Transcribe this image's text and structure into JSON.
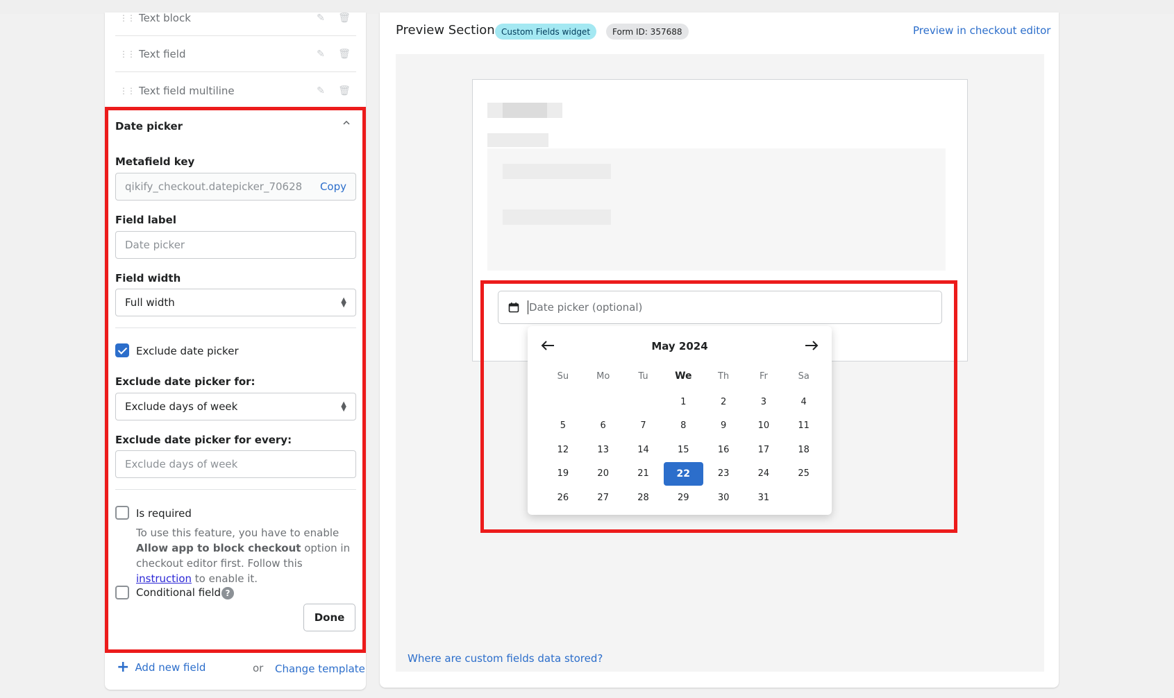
{
  "field_list": [
    {
      "label": "Text block"
    },
    {
      "label": "Text field"
    },
    {
      "label": "Text field multiline"
    }
  ],
  "date_picker_panel": {
    "title": "Date picker",
    "metafield_key_label": "Metafield key",
    "metafield_key_value": "qikify_checkout.datepicker_70628",
    "copy_label": "Copy",
    "field_label_label": "Field label",
    "field_label_placeholder": "Date picker",
    "field_width_label": "Field width",
    "field_width_value": "Full width",
    "exclude_checkbox_label": "Exclude date picker",
    "exclude_checked": true,
    "exclude_for_label": "Exclude date picker for:",
    "exclude_for_value": "Exclude days of week",
    "exclude_every_label": "Exclude date picker for every:",
    "exclude_every_placeholder": "Exclude days of week",
    "is_required_label": "Is required",
    "is_required_checked": false,
    "help_pre": "To use this feature, you have to enable ",
    "help_bold": "Allow app to block checkout",
    "help_mid": " option in checkout editor first. Follow this ",
    "help_link": "instruction",
    "help_post": " to enable it.",
    "conditional_label": "Conditional field",
    "conditional_checked": false,
    "help_icon": "?",
    "done_label": "Done"
  },
  "footer": {
    "add_field_icon": "+",
    "add_field_label": "Add new field",
    "or_label": "or",
    "change_template_label": "Change template"
  },
  "preview": {
    "title": "Preview Section",
    "badge_widget": "Custom Fields widget",
    "badge_form": "Form ID: 357688",
    "editor_link": "Preview in checkout editor",
    "date_input_placeholder": "Date picker (optional)",
    "where_link": "Where are custom fields data stored?"
  },
  "calendar": {
    "month": "May 2024",
    "weekdays": [
      "Su",
      "Mo",
      "Tu",
      "We",
      "Th",
      "Fr",
      "Sa"
    ],
    "today_weekday": "We",
    "selected_day": "22",
    "weeks": [
      [
        "",
        "",
        "",
        "1",
        "2",
        "3",
        "4"
      ],
      [
        "5",
        "6",
        "7",
        "8",
        "9",
        "10",
        "11"
      ],
      [
        "12",
        "13",
        "14",
        "15",
        "16",
        "17",
        "18"
      ],
      [
        "19",
        "20",
        "21",
        "22",
        "23",
        "24",
        "25"
      ],
      [
        "26",
        "27",
        "28",
        "29",
        "30",
        "31",
        ""
      ]
    ]
  },
  "colors": {
    "accent": "#2c6ecb",
    "highlight": "#ec1b1b",
    "badge_teal": "#a4e8f2"
  }
}
